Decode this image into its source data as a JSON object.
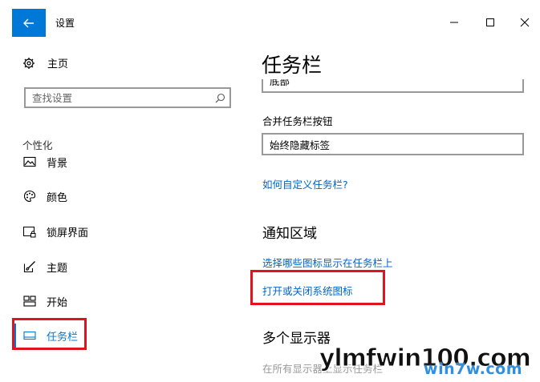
{
  "window": {
    "title": "设置"
  },
  "sidebar": {
    "home_label": "主页",
    "search_placeholder": "查找设置",
    "section_label": "个性化",
    "items": [
      {
        "label": "背景",
        "icon": "image-icon"
      },
      {
        "label": "颜色",
        "icon": "palette-icon"
      },
      {
        "label": "锁屏界面",
        "icon": "lock-screen-icon"
      },
      {
        "label": "主题",
        "icon": "theme-brush-icon"
      },
      {
        "label": "开始",
        "icon": "start-tiles-icon"
      },
      {
        "label": "任务栏",
        "icon": "taskbar-icon",
        "selected": true
      }
    ]
  },
  "main": {
    "title": "任务栏",
    "partial_dropdown_value": "底部",
    "combine_buttons_label": "合并任务栏按钮",
    "combine_buttons_value": "始终隐藏标签",
    "help_link": "如何自定义任务栏?",
    "notification_heading": "通知区域",
    "notification_links": [
      "选择哪些图标显示在任务栏上",
      "打开或关闭系统图标"
    ],
    "multi_display_heading": "多个显示器",
    "multi_display_text": "在所有显示器上显示任务栏"
  },
  "watermark": {
    "line1": "ylmfwin100.com",
    "line2": "win7w.com"
  },
  "colors": {
    "accent": "#0078d7",
    "link": "#0066cc",
    "highlight_box": "#e0141e"
  }
}
